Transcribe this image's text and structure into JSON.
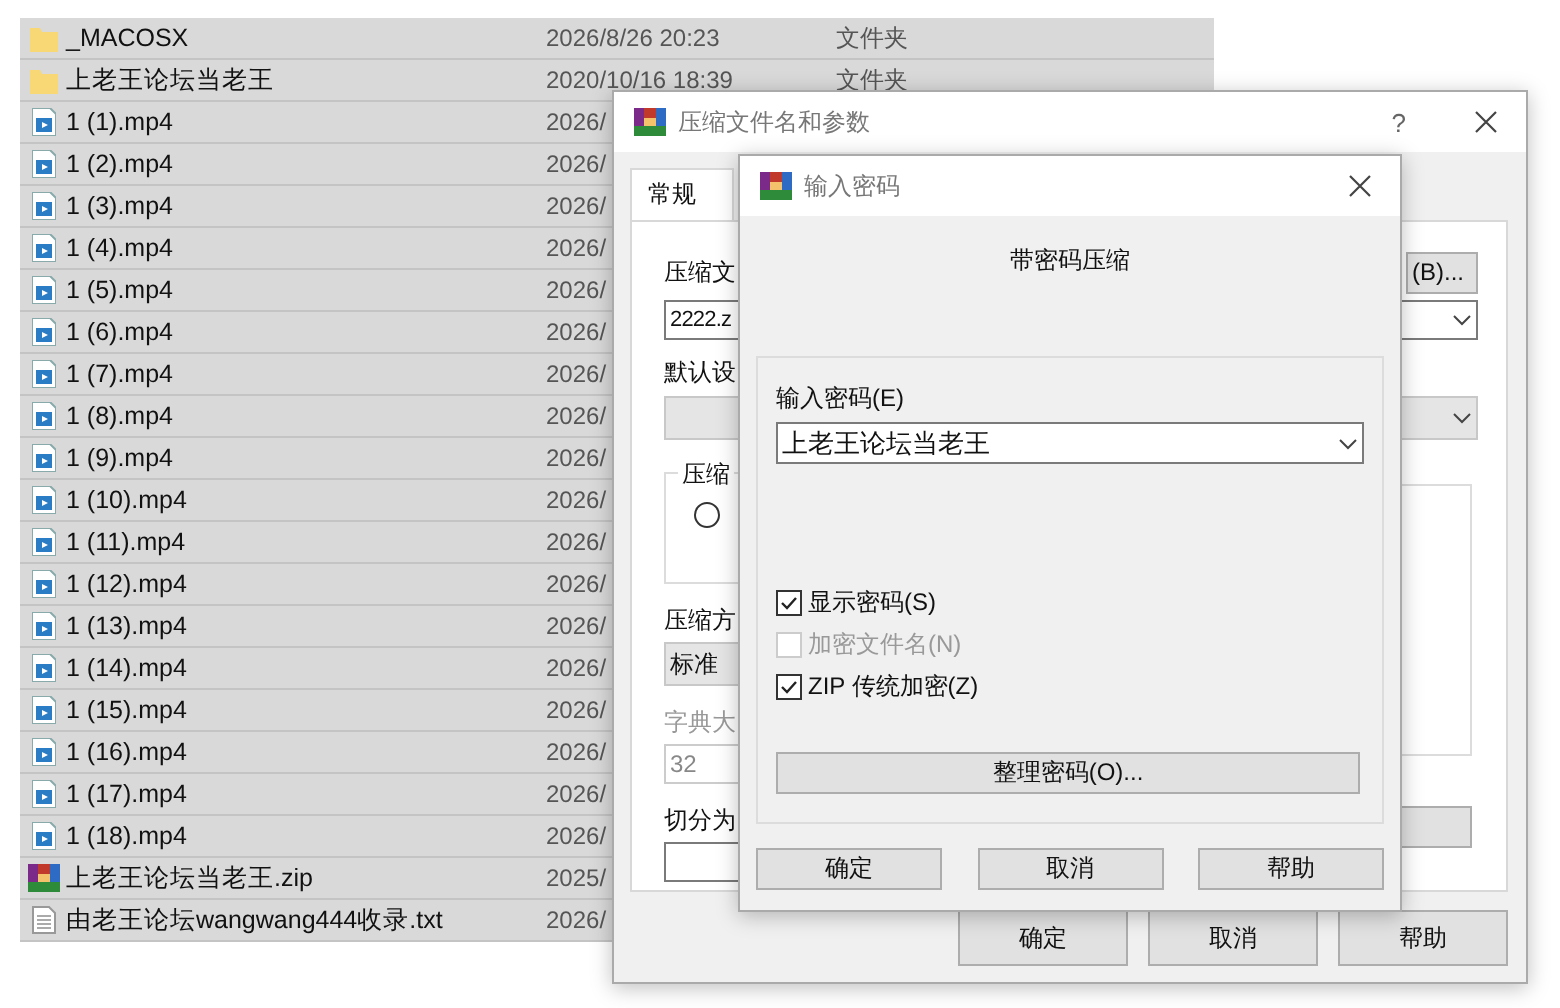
{
  "files": [
    {
      "name": "_MACOSX",
      "date": "2026/8/26 20:23",
      "type": "文件夹",
      "kind": "folder"
    },
    {
      "name": "上老王论坛当老王",
      "date": "2020/10/16 18:39",
      "type": "文件夹",
      "kind": "folder"
    },
    {
      "name": "1 (1).mp4",
      "date": "2026/",
      "kind": "video"
    },
    {
      "name": "1 (2).mp4",
      "date": "2026/",
      "kind": "video"
    },
    {
      "name": "1 (3).mp4",
      "date": "2026/",
      "kind": "video"
    },
    {
      "name": "1 (4).mp4",
      "date": "2026/",
      "kind": "video"
    },
    {
      "name": "1 (5).mp4",
      "date": "2026/",
      "kind": "video"
    },
    {
      "name": "1 (6).mp4",
      "date": "2026/",
      "kind": "video"
    },
    {
      "name": "1 (7).mp4",
      "date": "2026/",
      "kind": "video"
    },
    {
      "name": "1 (8).mp4",
      "date": "2026/",
      "kind": "video"
    },
    {
      "name": "1 (9).mp4",
      "date": "2026/",
      "kind": "video"
    },
    {
      "name": "1 (10).mp4",
      "date": "2026/",
      "kind": "video"
    },
    {
      "name": "1 (11).mp4",
      "date": "2026/",
      "kind": "video"
    },
    {
      "name": "1 (12).mp4",
      "date": "2026/",
      "kind": "video"
    },
    {
      "name": "1 (13).mp4",
      "date": "2026/",
      "kind": "video"
    },
    {
      "name": "1 (14).mp4",
      "date": "2026/",
      "kind": "video"
    },
    {
      "name": "1 (15).mp4",
      "date": "2026/",
      "kind": "video"
    },
    {
      "name": "1 (16).mp4",
      "date": "2026/",
      "kind": "video"
    },
    {
      "name": "1 (17).mp4",
      "date": "2026/",
      "kind": "video"
    },
    {
      "name": "1 (18).mp4",
      "date": "2026/",
      "kind": "video"
    },
    {
      "name": "上老王论坛当老王.zip",
      "date": "2025/",
      "kind": "archive"
    },
    {
      "name": "由老王论坛wangwang444收录.txt",
      "date": "2026/",
      "kind": "text"
    }
  ],
  "compress_dialog": {
    "title": "压缩文件名和参数",
    "help": "?",
    "tabs": [
      {
        "label": "常规",
        "selected": true
      }
    ],
    "archive_label": "压缩文",
    "browse_button": "(B)...",
    "archive_name": "2222.z",
    "profile_label": "默认设",
    "format_group": "压缩",
    "format_options": [
      {
        "selected": false
      }
    ],
    "method_label": "压缩方",
    "method": "标准",
    "dict_label": "字典大",
    "dict_size": "32",
    "split_label": "切分为",
    "buttons": [
      "确定",
      "取消",
      "帮助"
    ]
  },
  "password_dialog": {
    "title": "输入密码",
    "heading": "带密码压缩",
    "password_label": "输入密码(E)",
    "password": "上老王论坛当老王",
    "options": [
      {
        "label": "显示密码(S)",
        "checked": true,
        "disabled": false
      },
      {
        "label": "加密文件名(N)",
        "checked": false,
        "disabled": true
      },
      {
        "label": "ZIP 传统加密(Z)",
        "checked": true,
        "disabled": false
      }
    ],
    "organize_button": "整理密码(O)...",
    "buttons": [
      "确定",
      "取消",
      "帮助"
    ]
  }
}
